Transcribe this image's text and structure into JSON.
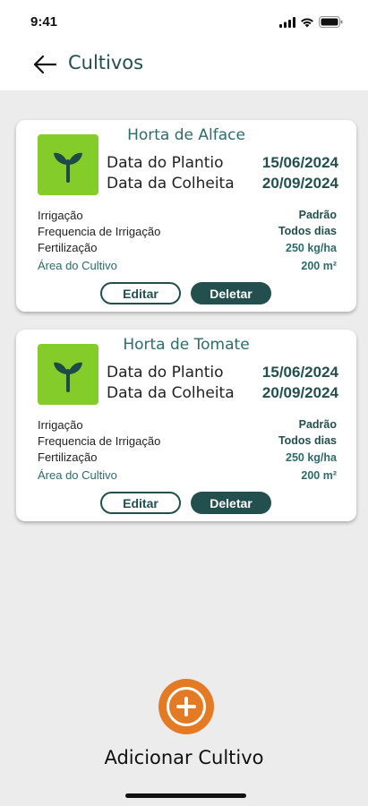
{
  "status_bar": {
    "time": "9:41"
  },
  "header": {
    "title": "Cultivos"
  },
  "crops": [
    {
      "title": "Horta de Alface",
      "planting_label": "Data do Plantio",
      "planting_date": "15/06/2024",
      "harvest_label": "Data da Colheita",
      "harvest_date": "20/09/2024",
      "irrigation_label": "Irrigação",
      "irrigation_value": "Padrão",
      "frequency_label": "Frequencia de Irrigação",
      "frequency_value": "Todos dias",
      "fertilization_label": "Fertilização",
      "fertilization_value": "250 kg/ha",
      "area_label": "Área do Cultivo",
      "area_value": "200 m²",
      "edit_label": "Editar",
      "delete_label": "Deletar"
    },
    {
      "title": "Horta de Tomate",
      "planting_label": "Data do Plantio",
      "planting_date": "15/06/2024",
      "harvest_label": "Data da Colheita",
      "harvest_date": "20/09/2024",
      "irrigation_label": "Irrigação",
      "irrigation_value": "Padrão",
      "frequency_label": "Frequencia de Irrigação",
      "frequency_value": "Todos dias",
      "fertilization_label": "Fertilização",
      "fertilization_value": "250 kg/ha",
      "area_label": "Área do Cultivo",
      "area_value": "200 m²",
      "edit_label": "Editar",
      "delete_label": "Deletar"
    }
  ],
  "add_button": {
    "label": "Adicionar Cultivo"
  },
  "colors": {
    "primary": "#234f4f",
    "accent_text": "#2e6b6b",
    "crop_image_bg": "#84cc2a",
    "add_button": "#e57a25",
    "background": "#ececec"
  },
  "icons": {
    "back": "arrow-left-icon",
    "crop": "sprout-icon",
    "add": "plus-circle-icon"
  }
}
